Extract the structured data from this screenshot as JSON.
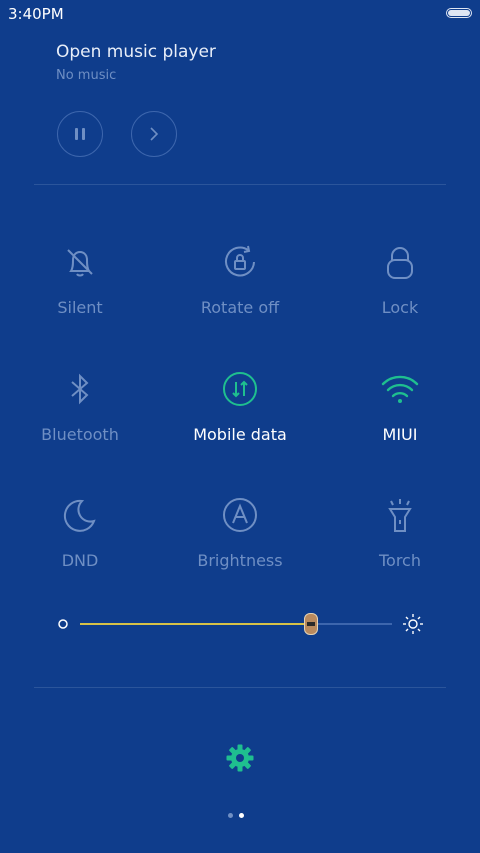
{
  "status_bar": {
    "time": "3:40PM",
    "battery_icon": "battery-icon"
  },
  "music": {
    "title": "Open music player",
    "subtitle": "No music",
    "pause_icon": "pause-icon",
    "next_icon": "chevron-right-icon"
  },
  "toggles": [
    {
      "label": "Silent",
      "icon": "bell-off-icon",
      "state": "off"
    },
    {
      "label": "Rotate off",
      "icon": "rotate-lock-icon",
      "state": "off"
    },
    {
      "label": "Lock",
      "icon": "lock-icon",
      "state": "off"
    },
    {
      "label": "Bluetooth",
      "icon": "bluetooth-icon",
      "state": "off"
    },
    {
      "label": "Mobile data",
      "icon": "mobile-data-icon",
      "state": "on"
    },
    {
      "label": "MIUI",
      "icon": "wifi-icon",
      "state": "on"
    },
    {
      "label": "DND",
      "icon": "moon-icon",
      "state": "off"
    },
    {
      "label": "Brightness",
      "icon": "auto-brightness-icon",
      "state": "off"
    },
    {
      "label": "Torch",
      "icon": "torch-icon",
      "state": "off"
    }
  ],
  "brightness": {
    "level": 0.74,
    "min_icon": "brightness-low-icon",
    "max_icon": "brightness-high-icon"
  },
  "colors": {
    "background": "#0f3d8c",
    "inactive": "#6f8fc4",
    "active_text": "#ffffff",
    "accent_green": "#1fbf8f",
    "slider_fill": "#d7c248"
  },
  "settings_icon": "gear-icon",
  "pager": {
    "pages": 2,
    "current": 2
  }
}
